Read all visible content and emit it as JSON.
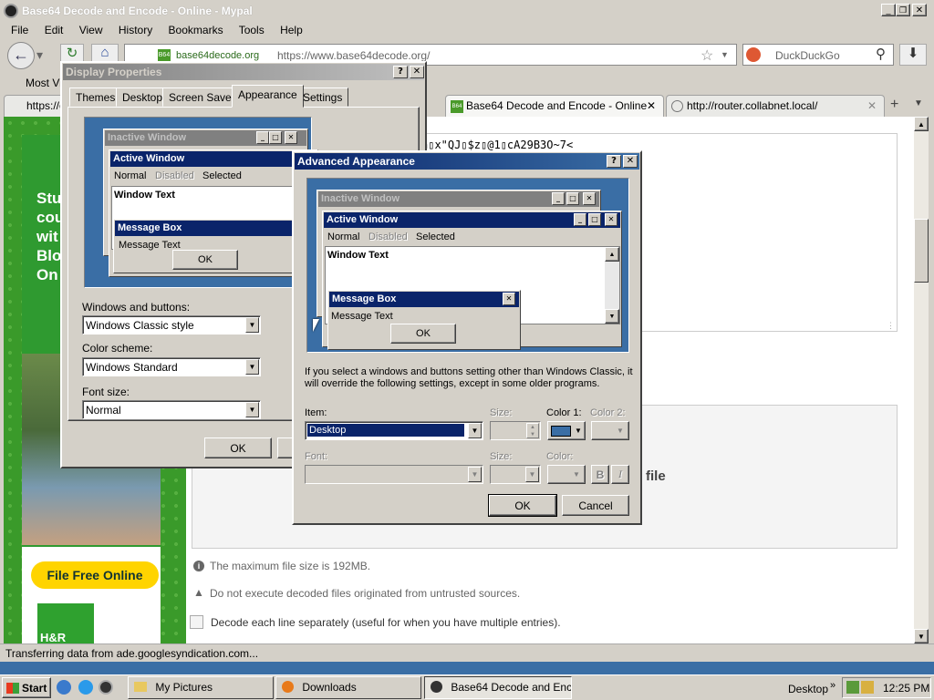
{
  "browser": {
    "title": "Base64 Decode and Encode - Online - Mypal",
    "menu": [
      "File",
      "Edit",
      "View",
      "History",
      "Bookmarks",
      "Tools",
      "Help"
    ],
    "site_badge": "base64decode.org",
    "url": "https://www.base64decode.org/",
    "search_placeholder": "DuckDuckGo",
    "bookmarks_label": "Most Visited",
    "tabs": [
      "https://c",
      "Base64 Decode and Encode - Online",
      "http://router.collabnet.local/"
    ],
    "status": "Transferring data from ade.googlesyndication.com..."
  },
  "page": {
    "garbled_text": "h▯x\"QJ▯$z▯@1▯cA29B3O~7<",
    "ad_text": [
      "Stu",
      "cou",
      "wit",
      "Blo",
      "On"
    ],
    "ad_button": "File Free Online",
    "ad_brand": "H&R",
    "file_word": "file",
    "notices": [
      "The maximum file size is 192MB.",
      "Do not execute decoded files originated from untrusted sources."
    ],
    "decode_lines_label": "Decode each line separately (useful for when you have multiple entries)."
  },
  "display_props": {
    "title": "Display Properties",
    "tabs": [
      "Themes",
      "Desktop",
      "Screen Saver",
      "Appearance",
      "Settings"
    ],
    "preview": {
      "inactive": "Inactive Window",
      "active": "Active Window",
      "menu": [
        "Normal",
        "Disabled",
        "Selected"
      ],
      "window_text": "Window Text",
      "message_box": "Message Box",
      "message_text": "Message Text",
      "ok": "OK"
    },
    "windows_buttons_label": "Windows and buttons:",
    "windows_buttons_value": "Windows Classic style",
    "color_scheme_label": "Color scheme:",
    "color_scheme_value": "Windows Standard",
    "font_size_label": "Font size:",
    "font_size_value": "Normal",
    "ok": "OK"
  },
  "advanced": {
    "title": "Advanced Appearance",
    "preview": {
      "inactive": "Inactive Window",
      "active": "Active Window",
      "menu": [
        "Normal",
        "Disabled",
        "Selected"
      ],
      "window_text": "Window Text",
      "message_box": "Message Box",
      "message_text": "Message Text",
      "ok": "OK"
    },
    "info": "If you select a windows and buttons setting other than Windows Classic, it will override the following settings, except in some older programs.",
    "item_label": "Item:",
    "item_value": "Desktop",
    "size_label": "Size:",
    "color1_label": "Color 1:",
    "color2_label": "Color 2:",
    "font_label": "Font:",
    "size2_label": "Size:",
    "color_label": "Color:",
    "bold": "B",
    "italic": "I",
    "ok": "OK",
    "cancel": "Cancel"
  },
  "taskbar": {
    "start": "Start",
    "items": [
      "My Pictures",
      "Downloads",
      "Base64 Decode and Enc..."
    ],
    "desktop_label": "Desktop",
    "clock": "12:25 PM"
  },
  "colors": {
    "titlebar_active": "#0a246a",
    "titlebar_inactive": "#808080",
    "desktop": "#3a6ea5",
    "ad_green": "#3a9a2a",
    "ad_yellow": "#ffd400"
  }
}
